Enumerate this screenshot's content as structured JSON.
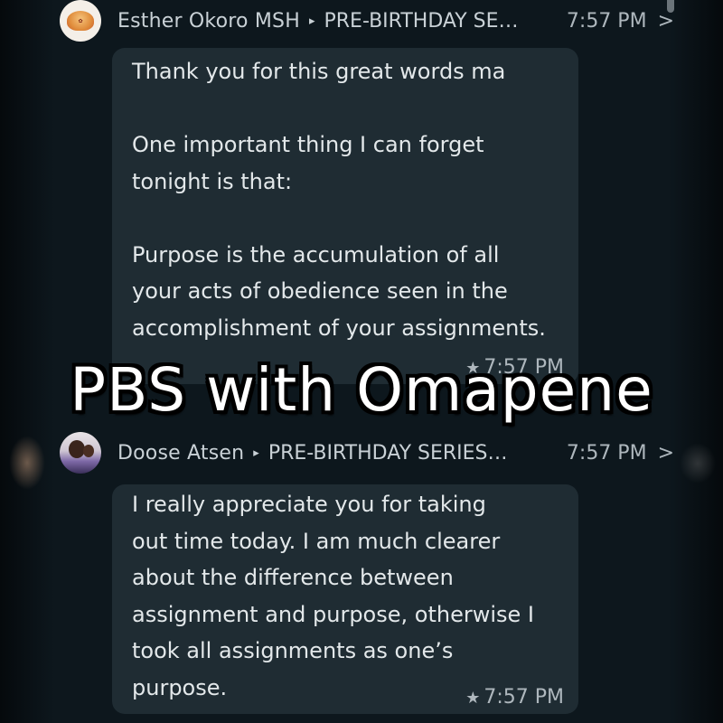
{
  "messages": [
    {
      "sender": "Esther Okoro MSH",
      "group": "PRE-BIRTHDAY SE…",
      "time": "7:57 PM",
      "paragraphs": [
        [
          "Thank you for this great words ma"
        ],
        [
          "One important thing I can forget",
          "tonight is that:"
        ],
        [
          "Purpose is the accumulation of all",
          "your acts of obedience seen in the",
          "accomplishment of your assignments."
        ]
      ],
      "footer_time": "7:57 PM",
      "starred": true,
      "avatar_icon": "logo-avatar"
    },
    {
      "sender": "Doose Atsen",
      "group": "PRE-BIRTHDAY SERIES…",
      "time": "7:57 PM",
      "paragraphs": [
        [
          "I really appreciate you for taking",
          "out time today. I am much clearer",
          "about the difference between",
          "assignment and purpose, otherwise I",
          "took all assignments as one’s",
          "purpose."
        ]
      ],
      "footer_time": "7:57 PM",
      "starred": true,
      "avatar_icon": "photo-avatar"
    }
  ],
  "overlay_text": "PBS with Omapene",
  "icons": {
    "separator": "triangle-right",
    "chevron": "chevron-right",
    "star": "star"
  },
  "colors": {
    "background": "#0d171d",
    "bubble": "#1f2c33",
    "text": "#e3e8ea",
    "meta": "#aeb7bd"
  }
}
